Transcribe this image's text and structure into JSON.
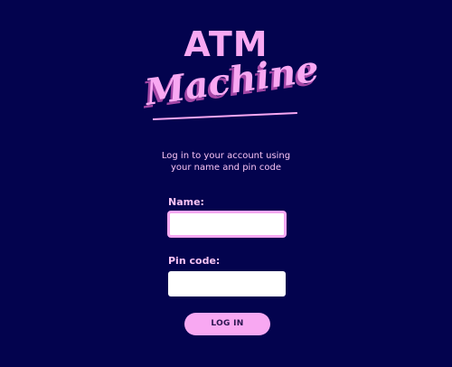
{
  "logo": {
    "title": "ATM",
    "script": "Machine"
  },
  "subtitle": {
    "line1": "Log in to your account using",
    "line2": "your name and pin code"
  },
  "form": {
    "name_label": "Name:",
    "name_value": "",
    "pin_label": "Pin code:",
    "pin_value": "",
    "login_label": "LOG IN"
  },
  "colors": {
    "background": "#03034e",
    "accent": "#f8a8f2",
    "text": "#f8c3f4"
  }
}
